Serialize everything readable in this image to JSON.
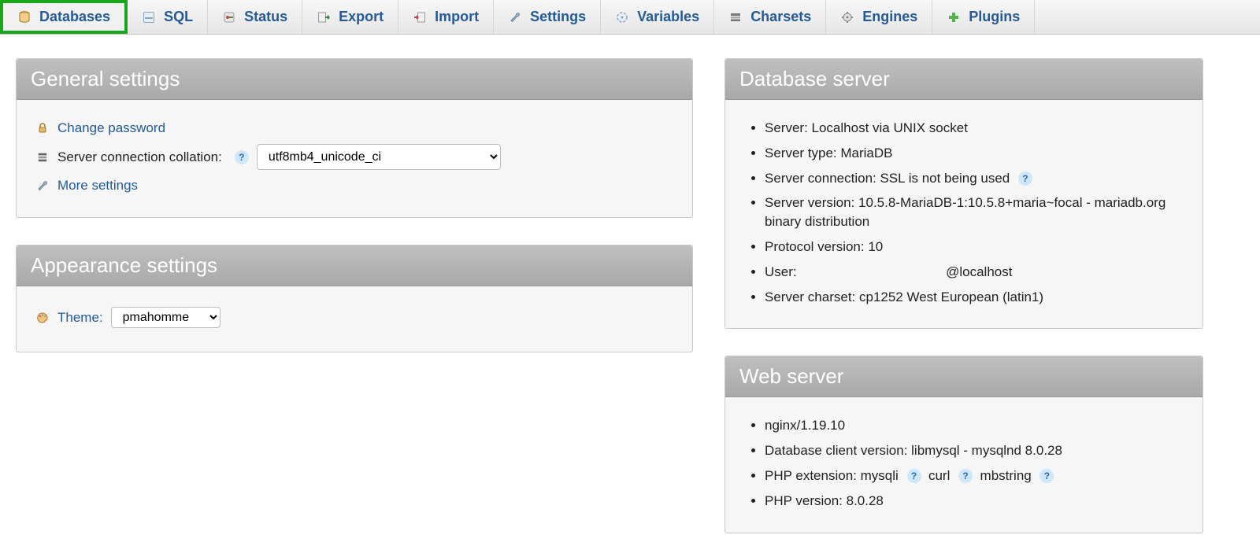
{
  "tabs": [
    {
      "id": "databases",
      "label": "Databases",
      "icon": "database-icon",
      "active": true
    },
    {
      "id": "sql",
      "label": "SQL",
      "icon": "sql-icon"
    },
    {
      "id": "status",
      "label": "Status",
      "icon": "status-icon"
    },
    {
      "id": "export",
      "label": "Export",
      "icon": "export-icon"
    },
    {
      "id": "import",
      "label": "Import",
      "icon": "import-icon"
    },
    {
      "id": "settings",
      "label": "Settings",
      "icon": "wrench-icon"
    },
    {
      "id": "variables",
      "label": "Variables",
      "icon": "variables-icon"
    },
    {
      "id": "charsets",
      "label": "Charsets",
      "icon": "charsets-icon"
    },
    {
      "id": "engines",
      "label": "Engines",
      "icon": "engines-icon"
    },
    {
      "id": "plugins",
      "label": "Plugins",
      "icon": "plugins-icon"
    }
  ],
  "general": {
    "title": "General settings",
    "change_password": "Change password",
    "collation_label": "Server connection collation:",
    "collation_value": "utf8mb4_unicode_ci",
    "more_settings": "More settings"
  },
  "appearance": {
    "title": "Appearance settings",
    "theme_label": "Theme:",
    "theme_value": "pmahomme"
  },
  "dbserver": {
    "title": "Database server",
    "items": {
      "server": "Server: Localhost via UNIX socket",
      "type": "Server type: MariaDB",
      "connection": "Server connection: SSL is not being used",
      "version": "Server version: 10.5.8-MariaDB-1:10.5.8+maria~focal - mariadb.org binary distribution",
      "protocol": "Protocol version: 10",
      "user_label": "User:",
      "user_suffix": "@localhost",
      "charset": "Server charset: cp1252 West European (latin1)"
    }
  },
  "webserver": {
    "title": "Web server",
    "items": {
      "nginx": "nginx/1.19.10",
      "dbclient": "Database client version: libmysql - mysqlnd 8.0.28",
      "phpext_prefix": "PHP extension: ",
      "phpext_mysqli": "mysqli",
      "phpext_curl": "curl",
      "phpext_mbstr": "mbstring",
      "phpver": "PHP version: 8.0.28"
    }
  }
}
